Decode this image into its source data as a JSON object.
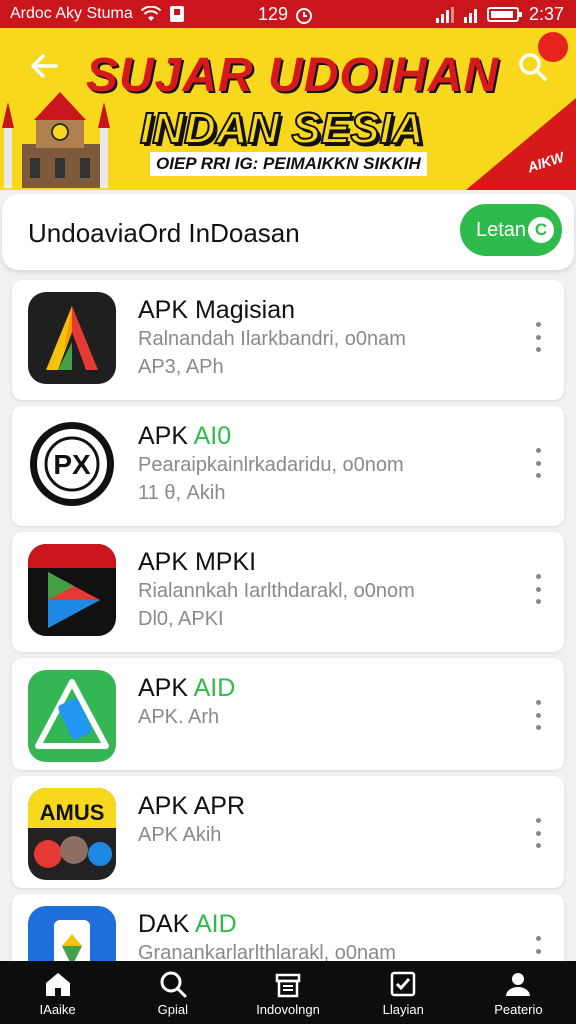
{
  "status_bar": {
    "carrier": "Ardoc Aky Stuma",
    "center_value": "129",
    "time": "2:37"
  },
  "banner": {
    "title_line1": "SUJAR UDOIHAN",
    "title_line2": "INDAN SESIA",
    "subtitle": "OIEP RRI IG: PEIMAIKKN SIKKIH",
    "corner_text": "AIKW",
    "colors": {
      "background": "#f7d81c",
      "red": "#d8191b"
    }
  },
  "search_card": {
    "text": "UndoaviaOrd InDoasan",
    "button_label": "Letan"
  },
  "apps": [
    {
      "name": "APK Magisian",
      "name_accent": "",
      "line1": "Ralnandah Ilarkbandri, o0nam",
      "line2": "AP3, APh",
      "icon": "red-a-logo-icon"
    },
    {
      "name": "APK ",
      "name_accent": "AI0",
      "line1": "Pearaipkainlrkadaridu, o0nom",
      "line2": "11 θ, Akih",
      "icon": "pk-badge-icon"
    },
    {
      "name": "APK MPKI",
      "name_accent": "",
      "line1": "Rialannkah Iarlthdarakl, o0nom",
      "line2": "Dl0, APKI",
      "icon": "apk-arrow-icon"
    },
    {
      "name": "APK ",
      "name_accent": "AID",
      "line1": "APK. Arh",
      "line2": "",
      "icon": "green-triangle-icon"
    },
    {
      "name": "APK APR",
      "name_accent": "",
      "line1": "APK Akih",
      "line2": "",
      "icon": "amus-poster-icon"
    },
    {
      "name": "DAK ",
      "name_accent": "AID",
      "line1": "Granankarlarlthlarakl, o0nam",
      "line2": "",
      "icon": "blue-phone-icon"
    }
  ],
  "bottom_nav": [
    {
      "label": "IAaike",
      "icon": "home-icon"
    },
    {
      "label": "Gpial",
      "icon": "search-icon"
    },
    {
      "label": "Indovolngn",
      "icon": "archive-icon"
    },
    {
      "label": "Llayian",
      "icon": "checkbox-icon"
    },
    {
      "label": "Peaterio",
      "icon": "profile-icon"
    }
  ]
}
